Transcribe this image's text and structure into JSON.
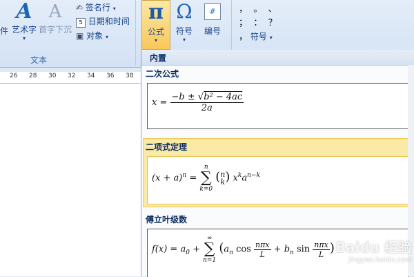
{
  "ribbon": {
    "file_partial": "件",
    "wordart": "艺术字",
    "dropcap": "首字下沉",
    "signature_line": "签名行",
    "date_time": "日期和时间",
    "object": "对象",
    "group_text": "文本",
    "equation": "公式",
    "symbol": "符号",
    "number": "编号",
    "symbol2": "符号",
    "pi_glyph": "π",
    "omega_glyph": "Ω",
    "hash_glyph": "#",
    "punct_row1": "，  。  、",
    "punct_row2": "；  ：  ？",
    "punct_row3": "，"
  },
  "ruler": {
    "ticks": [
      "26",
      "28",
      "30",
      "32",
      "34",
      "36",
      "38"
    ]
  },
  "equation_panel": {
    "header": "内置",
    "sections": [
      {
        "title": "二次公式",
        "formula": "x = (−b ± √(b² − 4ac)) / 2a"
      },
      {
        "title": "二项式定理",
        "formula": "(x + a)ⁿ = Σ_{k=0}^{n} (n k) xᵏ aⁿ⁻ᵏ"
      },
      {
        "title": "傅立叶级数",
        "formula": "f(x) = a₀ + Σ_{n=1}^{∞} (aₙ cos(nπx/L) + bₙ sin(nπx/L))"
      }
    ]
  },
  "watermark": {
    "text": "Baidu 经验",
    "url": "jingyan.baidu.com"
  }
}
